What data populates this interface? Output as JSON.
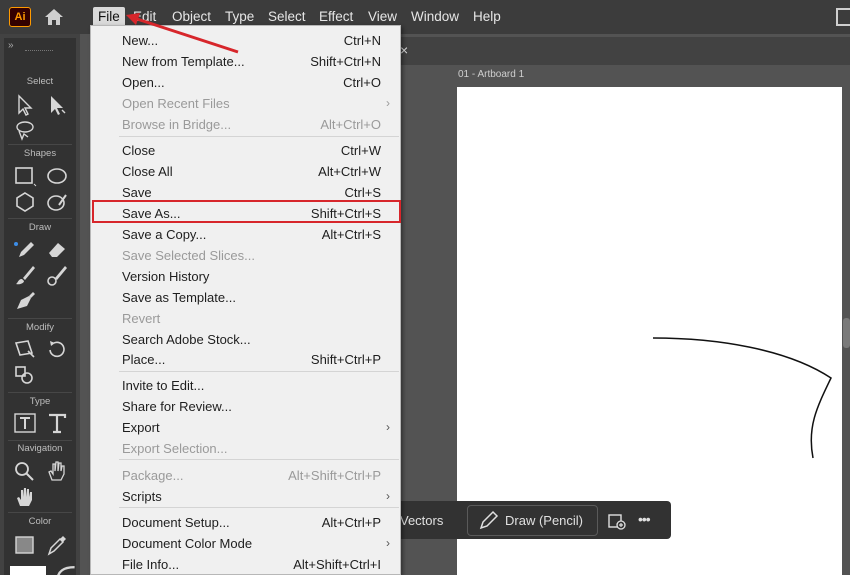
{
  "menubar": {
    "logo": "Ai",
    "items": [
      "File",
      "Edit",
      "Object",
      "Type",
      "Select",
      "Effect",
      "View",
      "Window",
      "Help"
    ]
  },
  "toolbar": {
    "header": "»",
    "sections": [
      "Select",
      "Shapes",
      "Draw",
      "Modify",
      "Type",
      "Navigation",
      "Color"
    ]
  },
  "document": {
    "tab_close": "×",
    "artboard_label": "01 - Artboard 1"
  },
  "taskbar": {
    "vectors_label": "Vectors",
    "draw_label": "Draw (Pencil)",
    "more": "•••"
  },
  "file_menu": {
    "items": [
      {
        "label": "New...",
        "shortcut": "Ctrl+N",
        "disabled": false,
        "submenu": false
      },
      {
        "label": "New from Template...",
        "shortcut": "Shift+Ctrl+N",
        "disabled": false,
        "submenu": false
      },
      {
        "label": "Open...",
        "shortcut": "Ctrl+O",
        "disabled": false,
        "submenu": false
      },
      {
        "label": "Open Recent Files",
        "shortcut": "",
        "disabled": true,
        "submenu": true
      },
      {
        "label": "Browse in Bridge...",
        "shortcut": "Alt+Ctrl+O",
        "disabled": true,
        "submenu": false
      },
      {
        "label": "Close",
        "shortcut": "Ctrl+W",
        "disabled": false,
        "submenu": false
      },
      {
        "label": "Close All",
        "shortcut": "Alt+Ctrl+W",
        "disabled": false,
        "submenu": false
      },
      {
        "label": "Save",
        "shortcut": "Ctrl+S",
        "disabled": false,
        "submenu": false
      },
      {
        "label": "Save As...",
        "shortcut": "Shift+Ctrl+S",
        "disabled": false,
        "submenu": false
      },
      {
        "label": "Save a Copy...",
        "shortcut": "Alt+Ctrl+S",
        "disabled": false,
        "submenu": false
      },
      {
        "label": "Save Selected Slices...",
        "shortcut": "",
        "disabled": true,
        "submenu": false
      },
      {
        "label": "Version History",
        "shortcut": "",
        "disabled": false,
        "submenu": false
      },
      {
        "label": "Save as Template...",
        "shortcut": "",
        "disabled": false,
        "submenu": false
      },
      {
        "label": "Revert",
        "shortcut": "",
        "disabled": true,
        "submenu": false
      },
      {
        "label": "Search Adobe Stock...",
        "shortcut": "",
        "disabled": false,
        "submenu": false
      },
      {
        "label": "Place...",
        "shortcut": "Shift+Ctrl+P",
        "disabled": false,
        "submenu": false
      },
      {
        "label": "Invite to Edit...",
        "shortcut": "",
        "disabled": false,
        "submenu": false
      },
      {
        "label": "Share for Review...",
        "shortcut": "",
        "disabled": false,
        "submenu": false
      },
      {
        "label": "Export",
        "shortcut": "",
        "disabled": false,
        "submenu": true
      },
      {
        "label": "Export Selection...",
        "shortcut": "",
        "disabled": true,
        "submenu": false
      },
      {
        "label": "Package...",
        "shortcut": "Alt+Shift+Ctrl+P",
        "disabled": true,
        "submenu": false
      },
      {
        "label": "Scripts",
        "shortcut": "",
        "disabled": false,
        "submenu": true
      },
      {
        "label": "Document Setup...",
        "shortcut": "Alt+Ctrl+P",
        "disabled": false,
        "submenu": false
      },
      {
        "label": "Document Color Mode",
        "shortcut": "",
        "disabled": false,
        "submenu": true
      },
      {
        "label": "File Info...",
        "shortcut": "Alt+Shift+Ctrl+I",
        "disabled": false,
        "submenu": false
      }
    ]
  },
  "colors": {
    "menubar_bg": "#3c3c3c",
    "toolbar_bg": "#323232",
    "menu_bg": "#f0f0f0",
    "highlight": "#d7262b",
    "logo_accent": "#ff9a00"
  }
}
